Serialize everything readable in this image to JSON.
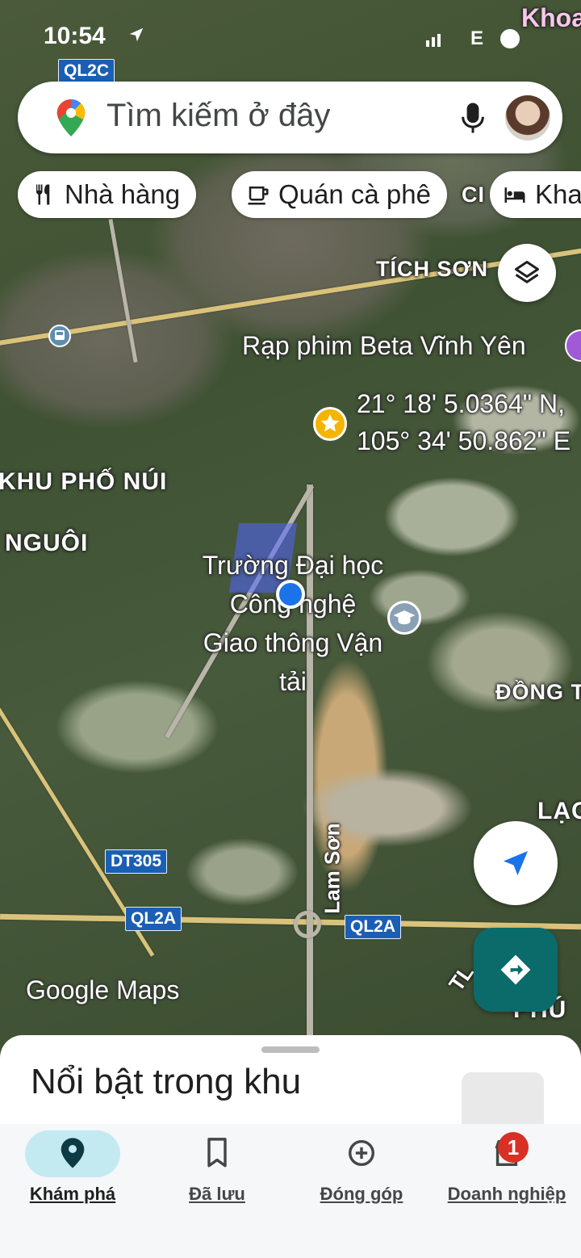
{
  "status_bar": {
    "time": "10:54",
    "network": "E",
    "corner_text": "Khoa"
  },
  "search": {
    "placeholder": "Tìm kiếm ở đây"
  },
  "chips": [
    {
      "label": "Nhà hàng",
      "icon": "fork-knife-icon"
    },
    {
      "label": "Quán cà phê",
      "icon": "coffee-cup-icon"
    },
    {
      "label": "Kha",
      "icon": "bed-icon"
    }
  ],
  "map": {
    "area_labels": {
      "tich_son": "TÍCH SƠN",
      "khu_pho_nui": "KHU PHỐ NÚI",
      "nguoi": "NGUÔI",
      "dong": "ĐỒNG T",
      "lac": "LẠC",
      "phu": "PHÚ",
      "ci": "CI"
    },
    "road_shields": [
      "QL2C",
      "DT305",
      "QL2A",
      "QL2A"
    ],
    "road_names": {
      "lam_son": "Lam Sơn",
      "tl": "TL"
    },
    "pois": {
      "cinema": "Rạp phim Beta Vĩnh Yên",
      "university": "Trường Đại học Công nghệ Giao thông Vận tải"
    },
    "dropped_pin": {
      "lat": "21° 18' 5.0364\" N,",
      "lng": "105° 34' 50.862\" E"
    },
    "watermark": "Google Maps"
  },
  "sheet": {
    "title": "Nổi bật trong khu vực"
  },
  "nav": [
    {
      "label": "Khám phá",
      "icon": "explore-pin-icon",
      "active": true
    },
    {
      "label": "Đã lưu",
      "icon": "bookmark-icon",
      "active": false
    },
    {
      "label": "Đóng góp",
      "icon": "add-circle-icon",
      "active": false
    },
    {
      "label": "Doanh nghiệp",
      "icon": "business-store-icon",
      "active": false,
      "badge": "1"
    }
  ],
  "colors": {
    "accent": "#0b6b6b",
    "nav_active_pill": "#c4eaf1",
    "location_dot": "#1a73e8",
    "shield": "#1a5fb4",
    "badge": "#d93025"
  }
}
